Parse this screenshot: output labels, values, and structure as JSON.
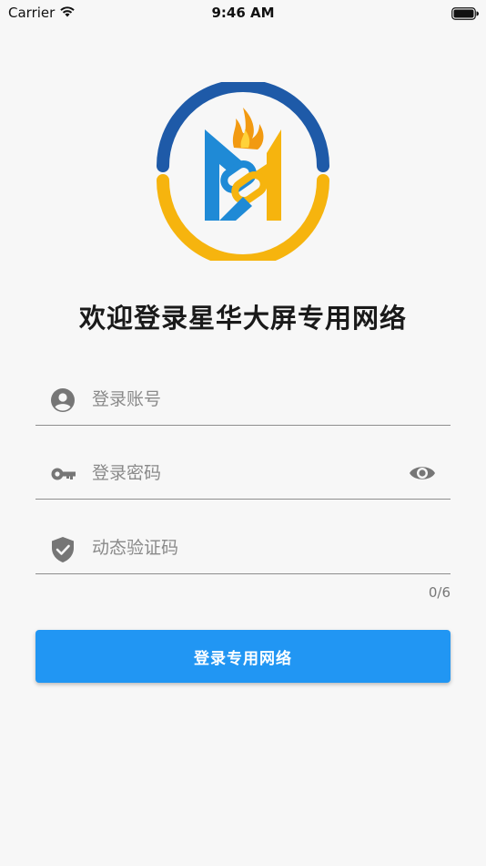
{
  "status_bar": {
    "carrier": "Carrier",
    "time": "9:46 AM",
    "wifi_icon": "wifi-icon",
    "battery_icon": "battery-icon"
  },
  "logo": {
    "icon": "brand-logo",
    "colors": {
      "blue": "#1e5aa8",
      "yellow": "#f6b40e",
      "flame": "#f29a11",
      "chain_blue": "#1f8ad6"
    }
  },
  "title": "欢迎登录星华大屏专用网络",
  "form": {
    "account": {
      "placeholder": "登录账号",
      "value": "",
      "icon": "account-circle-icon"
    },
    "password": {
      "placeholder": "登录密码",
      "value": "",
      "icon": "key-icon",
      "toggle_icon": "eye-icon"
    },
    "code": {
      "placeholder": "动态验证码",
      "value": "",
      "icon": "shield-check-icon",
      "counter": "0/6"
    }
  },
  "submit": {
    "label": "登录专用网络",
    "color": "#2196f3"
  }
}
